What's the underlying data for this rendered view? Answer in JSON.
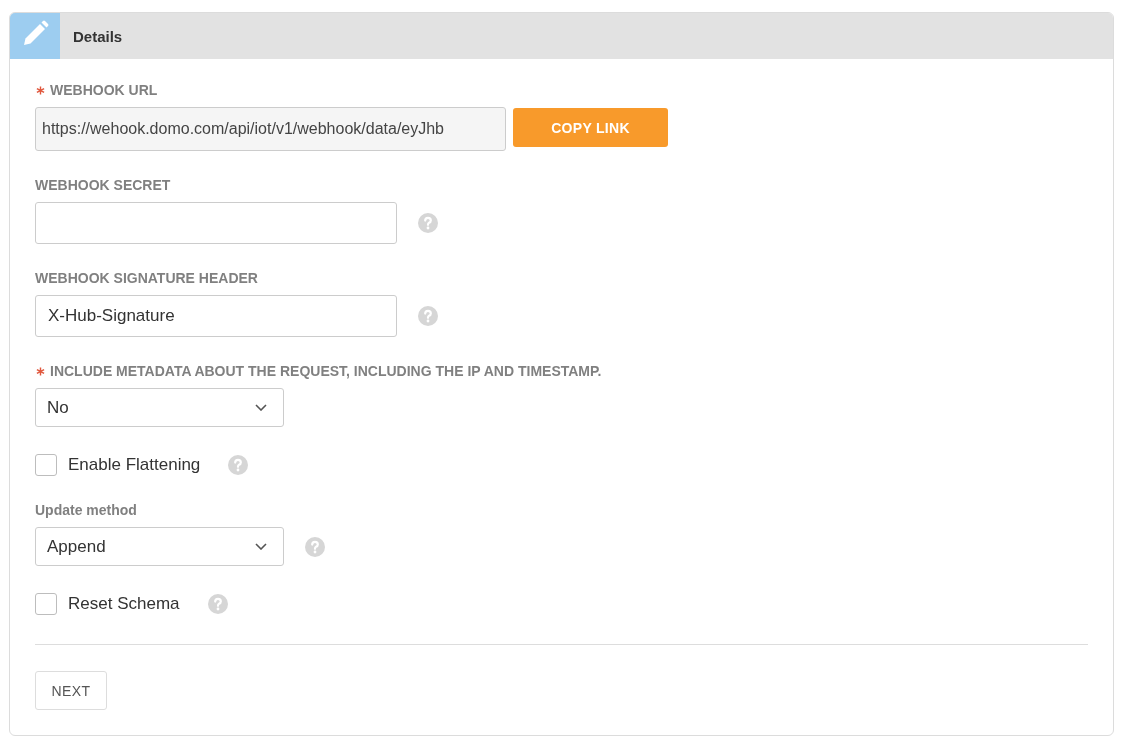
{
  "panel": {
    "title": "Details"
  },
  "fields": [
    {
      "kind": "link",
      "label": "WEBHOOK URL",
      "required": true,
      "value": "https://wehook.domo.com/api/iot/v1/webhook/data/eyJhb",
      "action": "COPY LINK",
      "help": false
    },
    {
      "kind": "text",
      "label": "WEBHOOK SECRET",
      "required": false,
      "help": true
    },
    {
      "kind": "text",
      "label": "WEBHOOK SIGNATURE HEADER",
      "required": false,
      "value": "X-Hub-Signature",
      "help": true
    },
    {
      "kind": "select",
      "label": "INCLUDE METADATA ABOUT THE REQUEST, INCLUDING THE IP AND TIMESTAMP.",
      "required": true,
      "value": "No",
      "help": false
    },
    {
      "kind": "checkbox",
      "label": "Enable Flattening",
      "checked": false,
      "help": true
    },
    {
      "kind": "select",
      "label": "Update method",
      "required": false,
      "value": "Append",
      "help": true
    },
    {
      "kind": "checkbox",
      "label": "Reset Schema",
      "checked": false,
      "help": true
    }
  ],
  "buttons": [
    "NEXT"
  ]
}
